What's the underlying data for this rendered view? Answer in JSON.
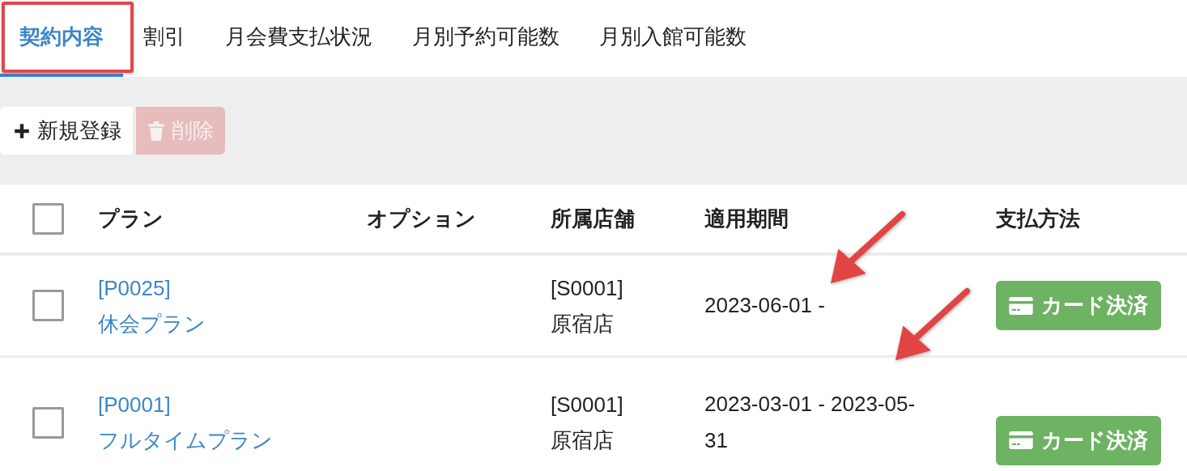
{
  "tabs": [
    {
      "label": "契約内容",
      "selected": true,
      "highlighted": true
    },
    {
      "label": "割引",
      "selected": false,
      "highlighted": false
    },
    {
      "label": "月会費支払状況",
      "selected": false,
      "highlighted": false
    },
    {
      "label": "月別予約可能数",
      "selected": false,
      "highlighted": false
    },
    {
      "label": "月別入館可能数",
      "selected": false,
      "highlighted": false
    }
  ],
  "toolbar": [
    {
      "kind": "add",
      "label": "新規登録",
      "disabled": false
    },
    {
      "kind": "delete",
      "label": "削除",
      "disabled": true
    }
  ],
  "table": {
    "select_all": {
      "checked": false
    },
    "columns": [
      "プラン",
      "オプション",
      "所属店舗",
      "適用期間",
      "支払方法"
    ],
    "rows": [
      {
        "checked": false,
        "plan_code": "[P0025]",
        "plan_name": "休会プラン",
        "store_code": "[S0001]",
        "store_name": "原宿店",
        "period": "2023-06-01 -",
        "payment": "カード決済"
      },
      {
        "checked": false,
        "plan_code": "[P0001]",
        "plan_name": "フルタイムプラン",
        "store_code": "[S0001]",
        "store_name": "原宿店",
        "period": "2023-03-01 - 2023-05-31",
        "payment": "カード決済"
      }
    ]
  },
  "annotations": [
    {
      "kind": "arrow"
    },
    {
      "kind": "arrow"
    }
  ]
}
